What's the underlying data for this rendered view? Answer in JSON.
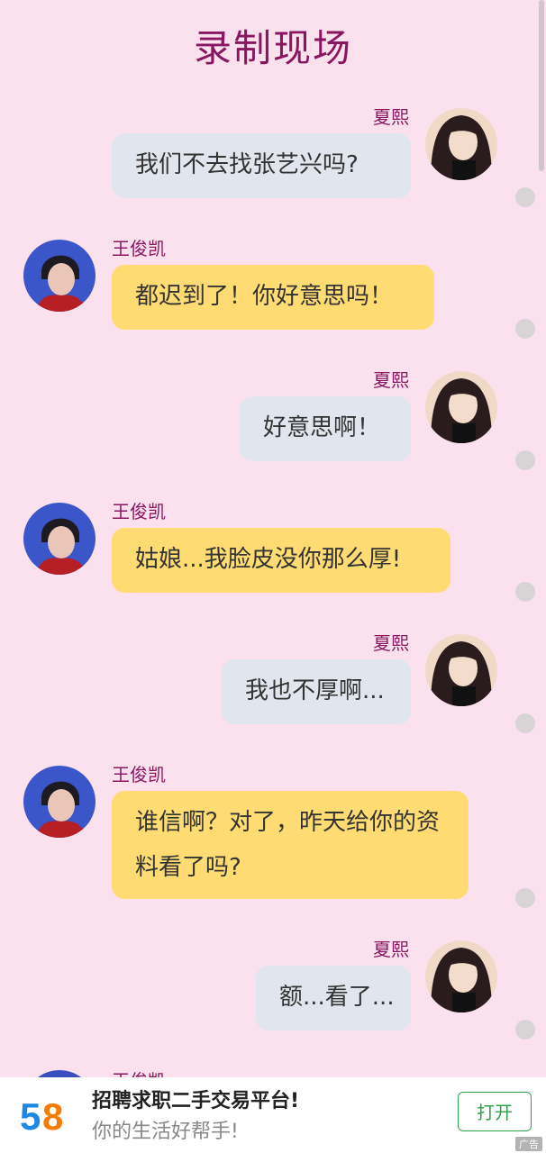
{
  "title": "录制现场",
  "chat": {
    "messages": [
      {
        "sender": "夏熙",
        "side": "right",
        "text": "我们不去找张艺兴吗?"
      },
      {
        "sender": "王俊凯",
        "side": "left",
        "text": "都迟到了！你好意思吗！"
      },
      {
        "sender": "夏熙",
        "side": "right",
        "text": "好意思啊！"
      },
      {
        "sender": "王俊凯",
        "side": "left",
        "text": "姑娘...我脸皮没你那么厚!"
      },
      {
        "sender": "夏熙",
        "side": "right",
        "text": "我也不厚啊..."
      },
      {
        "sender": "王俊凯",
        "side": "left",
        "text": "谁信啊？对了，昨天给你的资料看了吗?"
      },
      {
        "sender": "夏熙",
        "side": "right",
        "text": "额...看了..."
      },
      {
        "sender": "王俊凯",
        "side": "left",
        "text": ""
      }
    ]
  },
  "ad": {
    "logo": "58",
    "title": "招聘求职二手交易平台!",
    "subtitle": "你的生活好帮手!",
    "open_label": "打开",
    "tag": "广告"
  }
}
